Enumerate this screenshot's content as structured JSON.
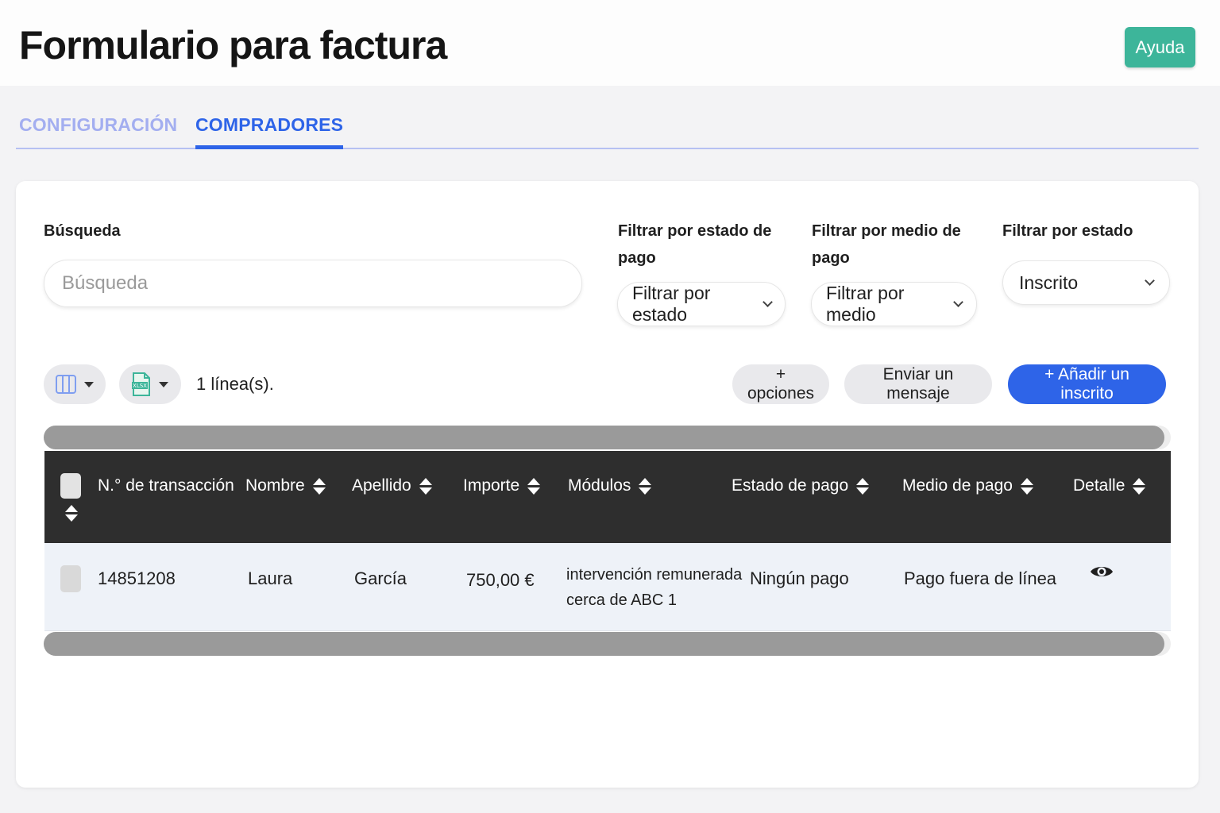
{
  "header": {
    "title": "Formulario para factura",
    "help_label": "Ayuda"
  },
  "tabs": [
    {
      "label": "CONFIGURACIÓN",
      "active": false
    },
    {
      "label": "COMPRADORES",
      "active": true
    }
  ],
  "filters": {
    "search_label": "Búsqueda",
    "search_placeholder": "Búsqueda",
    "payment_status_label_line1": "Filtrar por estado de",
    "payment_status_label_line2": "pago",
    "payment_status_value": "Filtrar por estado",
    "payment_method_label_line1": "Filtrar por medio de",
    "payment_method_label_line2": "pago",
    "payment_method_value": "Filtrar por medio",
    "status_label": "Filtrar por estado",
    "status_value": "Inscrito"
  },
  "toolbar": {
    "columns_icon": "columns-icon",
    "export_icon": "xlsx-file-icon",
    "row_count": "1 línea(s).",
    "options_label": "+ opciones",
    "message_label": "Enviar un mensaje",
    "add_label": "+ Añadir un inscrito"
  },
  "table": {
    "columns": [
      "N.° de transacción",
      "Nombre",
      "Apellido",
      "Importe",
      "Módulos",
      "Estado de pago",
      "Medio de pago",
      "Detalle"
    ],
    "rows": [
      {
        "transaction": "14851208",
        "first_name": "Laura",
        "last_name": "García",
        "amount": "750,00 €",
        "modules_line1": "intervención remunerada",
        "modules_line2": "cerca de ABC 1",
        "payment_status": "Ningún pago",
        "payment_method": "Pago fuera de línea",
        "detail_icon": "eye-icon"
      }
    ]
  },
  "colors": {
    "accent_blue": "#2e64e8",
    "help_green": "#3db59a",
    "table_header": "#2e2e2e",
    "row_background": "#eef2f8"
  }
}
